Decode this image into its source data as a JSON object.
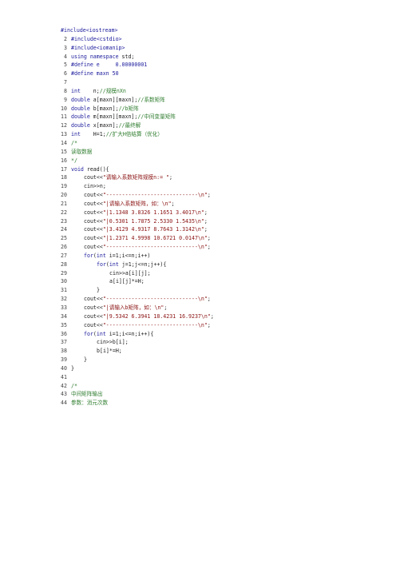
{
  "document": {
    "lines": [
      {
        "n": "",
        "ind": 0,
        "tokens": [
          {
            "t": "#include<iostream>",
            "c": "pp"
          }
        ]
      },
      {
        "n": "2",
        "ind": 0,
        "tokens": [
          {
            "t": "#include<cstdio>",
            "c": "pp"
          }
        ]
      },
      {
        "n": "3",
        "ind": 0,
        "tokens": [
          {
            "t": "#include<iomanip>",
            "c": "pp"
          }
        ]
      },
      {
        "n": "4",
        "ind": 0,
        "tokens": [
          {
            "t": "using namespace",
            "c": "kw"
          },
          {
            "t": " std;",
            "c": "plain"
          }
        ]
      },
      {
        "n": "5",
        "ind": 0,
        "tokens": [
          {
            "t": "#define e     0.00000001",
            "c": "pp"
          }
        ]
      },
      {
        "n": "6",
        "ind": 0,
        "tokens": [
          {
            "t": "#define maxn 50",
            "c": "pp"
          }
        ]
      },
      {
        "n": "7",
        "ind": 0,
        "tokens": []
      },
      {
        "n": "8",
        "ind": 0,
        "tokens": [
          {
            "t": "int",
            "c": "kw"
          },
          {
            "t": "    n;",
            "c": "plain"
          },
          {
            "t": "//规模nXn",
            "c": "cmt"
          }
        ]
      },
      {
        "n": "9",
        "ind": 0,
        "tokens": [
          {
            "t": "double",
            "c": "kw"
          },
          {
            "t": " a[maxn][maxn];",
            "c": "plain"
          },
          {
            "t": "//系数矩阵",
            "c": "cmt"
          }
        ]
      },
      {
        "n": "10",
        "ind": 0,
        "tokens": [
          {
            "t": "double",
            "c": "kw"
          },
          {
            "t": " b[maxn];",
            "c": "plain"
          },
          {
            "t": "//b矩阵",
            "c": "cmt"
          }
        ]
      },
      {
        "n": "11",
        "ind": 0,
        "tokens": [
          {
            "t": "double",
            "c": "kw"
          },
          {
            "t": " m[maxn][maxn];",
            "c": "plain"
          },
          {
            "t": "//中间变量矩阵",
            "c": "cmt"
          }
        ]
      },
      {
        "n": "12",
        "ind": 0,
        "tokens": [
          {
            "t": "double",
            "c": "kw"
          },
          {
            "t": " x[maxn];",
            "c": "plain"
          },
          {
            "t": "//最终解",
            "c": "cmt"
          }
        ]
      },
      {
        "n": "13",
        "ind": 0,
        "tokens": [
          {
            "t": "int",
            "c": "kw"
          },
          {
            "t": "    H=1;",
            "c": "plain"
          },
          {
            "t": "//扩大H倍结算（优化）",
            "c": "cmt"
          }
        ]
      },
      {
        "n": "14",
        "ind": 0,
        "tokens": [
          {
            "t": "/*",
            "c": "cmt"
          }
        ]
      },
      {
        "n": "15",
        "ind": 0,
        "tokens": [
          {
            "t": "读取数据",
            "c": "cmt"
          }
        ]
      },
      {
        "n": "16",
        "ind": 0,
        "tokens": [
          {
            "t": "*/",
            "c": "cmt"
          }
        ]
      },
      {
        "n": "17",
        "ind": 0,
        "tokens": [
          {
            "t": "void",
            "c": "kw"
          },
          {
            "t": " read(){",
            "c": "plain"
          }
        ]
      },
      {
        "n": "18",
        "ind": 1,
        "tokens": [
          {
            "t": "cout<<",
            "c": "plain"
          },
          {
            "t": "\"请输入系数矩阵规模n:= \"",
            "c": "str"
          },
          {
            "t": ";",
            "c": "plain"
          }
        ]
      },
      {
        "n": "19",
        "ind": 1,
        "tokens": [
          {
            "t": "cin>>n;",
            "c": "plain"
          }
        ]
      },
      {
        "n": "20",
        "ind": 1,
        "tokens": [
          {
            "t": "cout<<",
            "c": "plain"
          },
          {
            "t": "\"-----------------------------\\n\"",
            "c": "str"
          },
          {
            "t": ";",
            "c": "plain"
          }
        ]
      },
      {
        "n": "21",
        "ind": 1,
        "tokens": [
          {
            "t": "cout<<",
            "c": "plain"
          },
          {
            "t": "\"|请输入系数矩阵，如：\\n\"",
            "c": "str"
          },
          {
            "t": ";",
            "c": "plain"
          }
        ]
      },
      {
        "n": "22",
        "ind": 1,
        "tokens": [
          {
            "t": "cout<<",
            "c": "plain"
          },
          {
            "t": "\"|1.1348 3.8326 1.1651 3.4017\\n\"",
            "c": "str"
          },
          {
            "t": ";",
            "c": "plain"
          }
        ]
      },
      {
        "n": "23",
        "ind": 1,
        "tokens": [
          {
            "t": "cout<<",
            "c": "plain"
          },
          {
            "t": "\"|0.5301 1.7875 2.5330 1.5435\\n\"",
            "c": "str"
          },
          {
            "t": ";",
            "c": "plain"
          }
        ]
      },
      {
        "n": "24",
        "ind": 1,
        "tokens": [
          {
            "t": "cout<<",
            "c": "plain"
          },
          {
            "t": "\"|3.4129 4.9317 8.7643 1.3142\\n\"",
            "c": "str"
          },
          {
            "t": ";",
            "c": "plain"
          }
        ]
      },
      {
        "n": "25",
        "ind": 1,
        "tokens": [
          {
            "t": "cout<<",
            "c": "plain"
          },
          {
            "t": "\"|1.2371 4.9998 10.6721 0.0147\\n\"",
            "c": "str"
          },
          {
            "t": ";",
            "c": "plain"
          }
        ]
      },
      {
        "n": "26",
        "ind": 1,
        "tokens": [
          {
            "t": "cout<<",
            "c": "plain"
          },
          {
            "t": "\"-----------------------------\\n\"",
            "c": "str"
          },
          {
            "t": ";",
            "c": "plain"
          }
        ]
      },
      {
        "n": "27",
        "ind": 1,
        "tokens": [
          {
            "t": "for",
            "c": "kw"
          },
          {
            "t": "(",
            "c": "plain"
          },
          {
            "t": "int",
            "c": "kw"
          },
          {
            "t": " i=1;i<=n;i++)",
            "c": "plain"
          }
        ]
      },
      {
        "n": "28",
        "ind": 2,
        "tokens": [
          {
            "t": "for",
            "c": "kw"
          },
          {
            "t": "(",
            "c": "plain"
          },
          {
            "t": "int",
            "c": "kw"
          },
          {
            "t": " j=1;j<=n;j++){",
            "c": "plain"
          }
        ]
      },
      {
        "n": "29",
        "ind": 3,
        "tokens": [
          {
            "t": "cin>>a[i][j];",
            "c": "plain"
          }
        ]
      },
      {
        "n": "30",
        "ind": 3,
        "tokens": [
          {
            "t": "a[i][j]*=H;",
            "c": "plain"
          }
        ]
      },
      {
        "n": "31",
        "ind": 2,
        "tokens": [
          {
            "t": "}",
            "c": "plain"
          }
        ]
      },
      {
        "n": "32",
        "ind": 1,
        "tokens": [
          {
            "t": "cout<<",
            "c": "plain"
          },
          {
            "t": "\"-----------------------------\\n\"",
            "c": "str"
          },
          {
            "t": ";",
            "c": "plain"
          }
        ]
      },
      {
        "n": "33",
        "ind": 1,
        "tokens": [
          {
            "t": "cout<<",
            "c": "plain"
          },
          {
            "t": "\"|请输入b矩阵，如：\\n\"",
            "c": "str"
          },
          {
            "t": ";",
            "c": "plain"
          }
        ]
      },
      {
        "n": "34",
        "ind": 1,
        "tokens": [
          {
            "t": "cout<<",
            "c": "plain"
          },
          {
            "t": "\"|9.5342 6.3941 18.4231 16.9237\\n\"",
            "c": "str"
          },
          {
            "t": ";",
            "c": "plain"
          }
        ]
      },
      {
        "n": "35",
        "ind": 1,
        "tokens": [
          {
            "t": "cout<<",
            "c": "plain"
          },
          {
            "t": "\"-----------------------------\\n\"",
            "c": "str"
          },
          {
            "t": ";",
            "c": "plain"
          }
        ]
      },
      {
        "n": "36",
        "ind": 1,
        "tokens": [
          {
            "t": "for",
            "c": "kw"
          },
          {
            "t": "(",
            "c": "plain"
          },
          {
            "t": "int",
            "c": "kw"
          },
          {
            "t": " i=1;i<=n;i++){",
            "c": "plain"
          }
        ]
      },
      {
        "n": "37",
        "ind": 2,
        "tokens": [
          {
            "t": "cin>>b[i];",
            "c": "plain"
          }
        ]
      },
      {
        "n": "38",
        "ind": 2,
        "tokens": [
          {
            "t": "b[i]*=H;",
            "c": "plain"
          }
        ]
      },
      {
        "n": "39",
        "ind": 1,
        "tokens": [
          {
            "t": "}",
            "c": "plain"
          }
        ]
      },
      {
        "n": "40",
        "ind": 0,
        "tokens": [
          {
            "t": "}",
            "c": "plain"
          }
        ]
      },
      {
        "n": "41",
        "ind": 0,
        "tokens": []
      },
      {
        "n": "42",
        "ind": 0,
        "tokens": [
          {
            "t": "/*",
            "c": "cmt"
          }
        ]
      },
      {
        "n": "43",
        "ind": 0,
        "tokens": [
          {
            "t": "中间矩阵输出",
            "c": "cmt"
          }
        ]
      },
      {
        "n": "44",
        "ind": 0,
        "tokens": [
          {
            "t": "参数：消元次数",
            "c": "cmt"
          }
        ]
      }
    ]
  }
}
